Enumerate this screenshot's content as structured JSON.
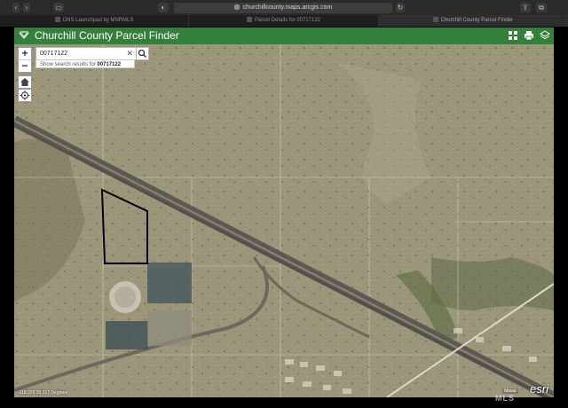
{
  "browser": {
    "url": "churchillcounty.maps.arcgis.com",
    "tabs": [
      {
        "label": "DNS Launchpad by MNRMLS",
        "active": false
      },
      {
        "label": "Parcel Details for 00717122",
        "active": false
      },
      {
        "label": "Churchill County Parcel Finder",
        "active": true
      }
    ]
  },
  "app": {
    "title": "Churchill County Parcel Finder",
    "accent": "#33803b"
  },
  "map": {
    "zoom_in": "+",
    "zoom_out": "−",
    "search_value": "00717122",
    "clear_label": "✕",
    "suggest_prefix": "Show search results for ",
    "suggest_value": "00717122",
    "coordinates": "-118.926 39.517 Degrees",
    "attribution": "Maxar",
    "esri_logo": "esri"
  },
  "watermark": "MLS",
  "icons": {
    "home": "home-icon",
    "locate": "locate-icon",
    "search": "search-icon",
    "grid": "grid-icon",
    "print": "print-icon",
    "layers": "layers-icon"
  }
}
